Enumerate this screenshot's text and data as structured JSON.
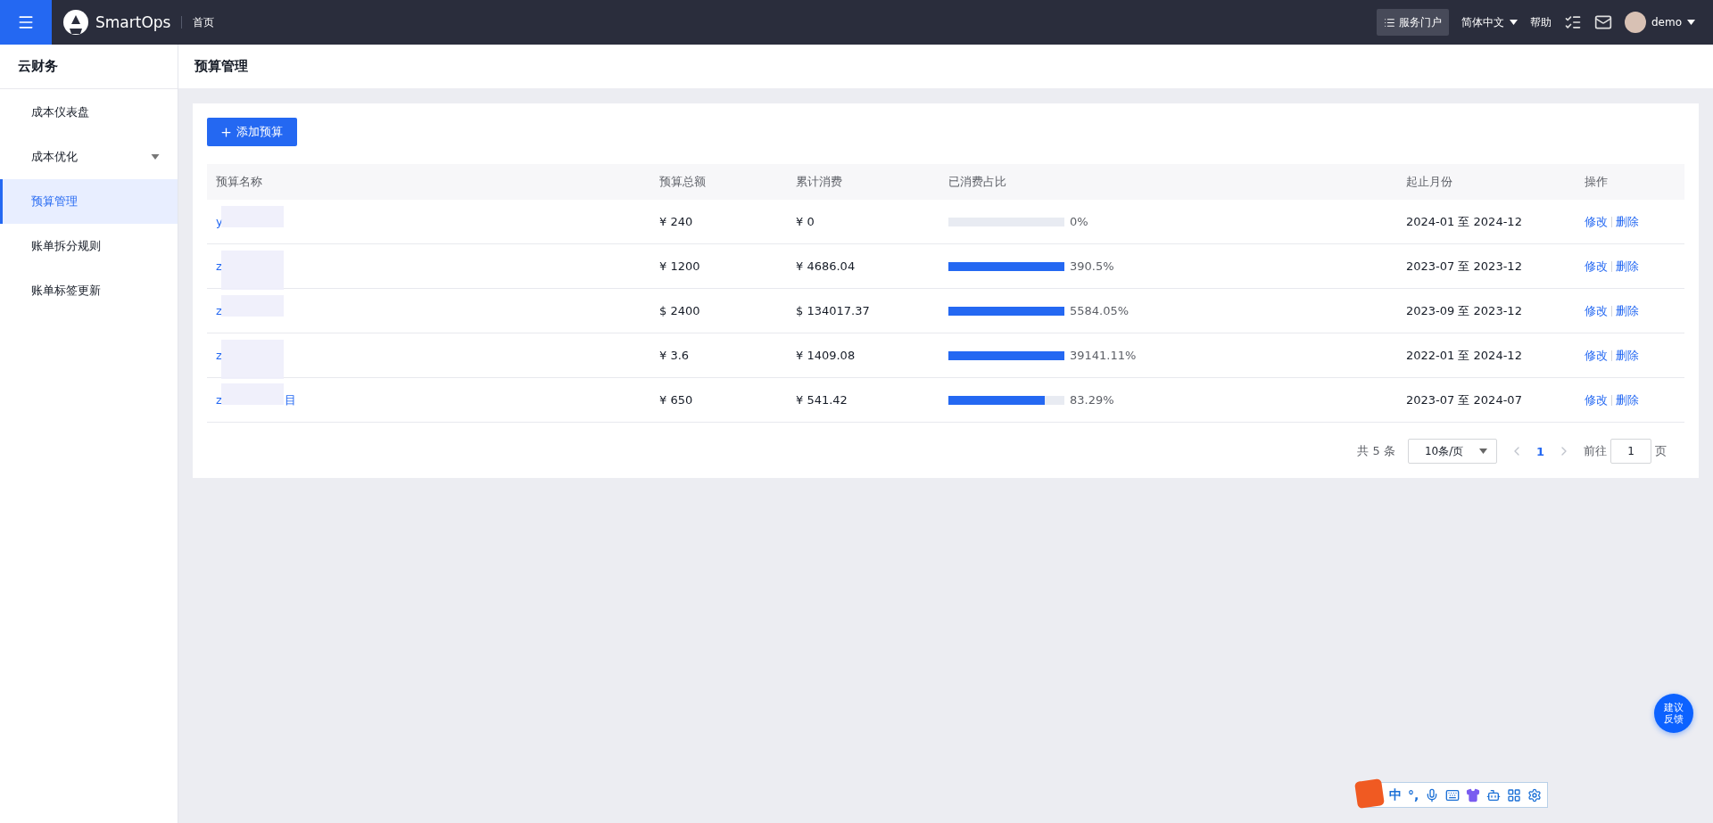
{
  "topbar": {
    "brand": "SmartOps",
    "breadcrumb": "首页",
    "portal": "服务门户",
    "language": "简体中文",
    "help": "帮助",
    "user": "demo"
  },
  "sidebar": {
    "title": "云财务",
    "items": [
      {
        "label": "成本仪表盘",
        "selected": false,
        "expandable": false
      },
      {
        "label": "成本优化",
        "selected": false,
        "expandable": true
      },
      {
        "label": "预算管理",
        "selected": true,
        "expandable": false
      },
      {
        "label": "账单拆分规则",
        "selected": false,
        "expandable": false
      },
      {
        "label": "账单标签更新",
        "selected": false,
        "expandable": false
      }
    ]
  },
  "page_title": "预算管理",
  "add_button": "添加预算",
  "table": {
    "columns": [
      "预算名称",
      "预算总额",
      "累计消费",
      "已消费占比",
      "起止月份",
      "操作"
    ],
    "rows": [
      {
        "name": "y",
        "name_end": "",
        "total": "¥ 240",
        "spent": "¥ 0",
        "level": 0,
        "ratio": "0%",
        "period": "2024-01 至 2024-12",
        "edit": "修改",
        "delete": "删除"
      },
      {
        "name": "z",
        "name_end": "",
        "total": "¥ 1200",
        "spent": "¥ 4686.04",
        "level": 1,
        "ratio": "390.5%",
        "period": "2023-07 至 2023-12",
        "edit": "修改",
        "delete": "删除"
      },
      {
        "name": "z",
        "name_end": "",
        "total": "$ 2400",
        "spent": "$ 134017.37",
        "level": 1,
        "ratio": "5584.05%",
        "period": "2023-09 至 2023-12",
        "edit": "修改",
        "delete": "删除"
      },
      {
        "name": "z",
        "name_end": "",
        "total": "¥ 3.6",
        "spent": "¥ 1409.08",
        "level": 1,
        "ratio": "39141.11%",
        "period": "2022-01 至 2024-12",
        "edit": "修改",
        "delete": "删除"
      },
      {
        "name": "z",
        "name_end": "目",
        "total": "¥ 650",
        "spent": "¥ 541.42",
        "level": 0.8329,
        "ratio": "83.29%",
        "period": "2023-07 至 2024-07",
        "edit": "修改",
        "delete": "删除"
      }
    ]
  },
  "pagination": {
    "total": "共 5 条",
    "page_size": "10条/页",
    "pages": [
      {
        "label": "1",
        "selected": true
      }
    ],
    "goto_label": "前往",
    "goto_value": "1",
    "goto_suffix": "页"
  },
  "feedback": {
    "line1": "建议",
    "line2": "反馈"
  },
  "ime_bar": {
    "mode": "中",
    "punct": "°,"
  }
}
